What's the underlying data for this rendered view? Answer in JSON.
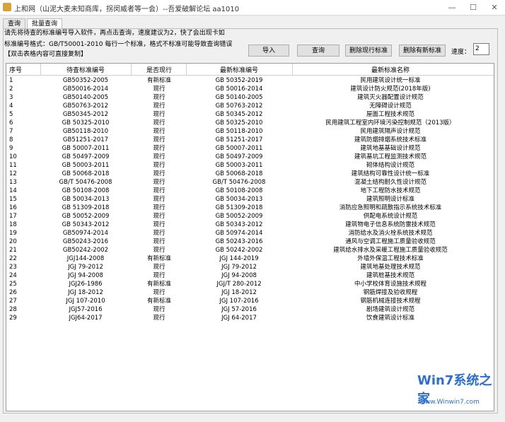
{
  "window": {
    "title": "上和网（山泥大麦未知商库，拐闵威者等一会）--吾爱破解论坛 aa1010",
    "controls": [
      "—",
      "☐",
      "✕"
    ]
  },
  "tabs": [
    {
      "label": "查询",
      "active": false
    },
    {
      "label": "批量查询",
      "active": true
    }
  ],
  "info": {
    "line1": "请先将待查的标准编号导入软件，再点击查询，速度建议为2，快了会出现卡如",
    "line2": "标准编号格式：GB/T50001-2010     每行一个标准，格式不标准可能导致查询错误",
    "line3": "【双击表格内容可直接复制】"
  },
  "buttons": {
    "import": "导入",
    "query": "查询",
    "delete_current": "删除现行标准",
    "delete_new": "删除有新标准"
  },
  "speed": {
    "label": "速度：",
    "value": "2"
  },
  "table": {
    "headers": [
      "序号",
      "待查标准编号",
      "是否现行",
      "最新标准编号",
      "最新标准名称"
    ],
    "rows": [
      [
        "1",
        "GB50352-2005",
        "有新标准",
        "GB 50352-2019",
        "民用建筑设计统一标准"
      ],
      [
        "2",
        "GB50016-2014",
        "现行",
        "GB 50016-2014",
        "建筑设计防火规范(2018年版)"
      ],
      [
        "3",
        "GB50140-2005",
        "现行",
        "GB 50140-2005",
        "建筑灭火器配置设计规范"
      ],
      [
        "4",
        "GB50763-2012",
        "现行",
        "GB 50763-2012",
        "无障碍设计规范"
      ],
      [
        "5",
        "GB50345-2012",
        "现行",
        "GB 50345-2012",
        "屋面工程技术规范"
      ],
      [
        "6",
        "GB 50325-2010",
        "现行",
        "GB 50325-2010",
        "民用建筑工程室内环境污染控制规范（2013版）"
      ],
      [
        "7",
        "GB50118-2010",
        "现行",
        "GB 50118-2010",
        "民用建筑隔声设计规范"
      ],
      [
        "8",
        "GB51251-2017",
        "现行",
        "GB 51251-2017",
        "建筑防烟排烟系统技术标准"
      ],
      [
        "9",
        "GB 50007-2011",
        "现行",
        "GB 50007-2011",
        "建筑地基基础设计规范"
      ],
      [
        "10",
        "GB 50497-2009",
        "现行",
        "GB 50497-2009",
        "建筑基坑工程监测技术规范"
      ],
      [
        "11",
        "GB 50003-2011",
        "现行",
        "GB 50003-2011",
        "砌体结构设计规范"
      ],
      [
        "12",
        "GB 50068-2018",
        "现行",
        "GB 50068-2018",
        "建筑结构可靠性设计统一标准"
      ],
      [
        "13",
        "GB/T 50476-2008",
        "现行",
        "GB/T 50476-2008",
        "混凝土结构耐久性设计规范"
      ],
      [
        "14",
        "GB 50108-2008",
        "现行",
        "GB 50108-2008",
        "地下工程防水技术规范"
      ],
      [
        "15",
        "GB 50034-2013",
        "现行",
        "GB 50034-2013",
        "建筑照明设计标准"
      ],
      [
        "16",
        "GB 51309-2018",
        "现行",
        "GB 51309-2018",
        "消防应急照明和疏散指示系统技术标准"
      ],
      [
        "17",
        "GB 50052-2009",
        "现行",
        "GB 50052-2009",
        "供配电系统设计规范"
      ],
      [
        "18",
        "GB 50343-2012",
        "现行",
        "GB 50343-2012",
        "建筑物电子信息系统防雷技术规范"
      ],
      [
        "19",
        "GB50974-2014",
        "现行",
        "GB 50974-2014",
        "消防给水及消火栓系统技术规范"
      ],
      [
        "20",
        "GB50243-2016",
        "现行",
        "GB 50243-2016",
        "通风与空调工程施工质量验收规范"
      ],
      [
        "21",
        "GB50242-2002",
        "现行",
        "GB 50242-2002",
        "建筑给水排水及采暖工程施工质量验收规范"
      ],
      [
        "22",
        "JGJ144-2008",
        "有新标准",
        "JGJ 144-2019",
        "外墙外保温工程技术标准"
      ],
      [
        "23",
        "JGJ 79-2012",
        "现行",
        "JGJ 79-2012",
        "建筑地基处理技术规范"
      ],
      [
        "24",
        "JGJ 94-2008",
        "现行",
        "JGJ 94-2008",
        "建筑桩基技术规范"
      ],
      [
        "25",
        "JGJ26-1986",
        "有新标准",
        "JGJ/T 280-2012",
        "中小学校体育设施技术规程"
      ],
      [
        "26",
        "JGJ 18-2012",
        "现行",
        "JGJ 18-2012",
        "钢筋焊接及验收规程"
      ],
      [
        "27",
        "JGJ 107-2010",
        "有新标准",
        "JGJ 107-2016",
        "钢筋机械连接技术规程"
      ],
      [
        "28",
        "JGJ57-2016",
        "现行",
        "JGJ 57-2016",
        "剧场建筑设计规范"
      ],
      [
        "29",
        "JGJ64-2017",
        "现行",
        "JGJ 64-2017",
        "饮食建筑设计标准"
      ]
    ]
  },
  "watermark": {
    "logo": "Win7系统之家",
    "url": "Www.Winwin7.com"
  }
}
